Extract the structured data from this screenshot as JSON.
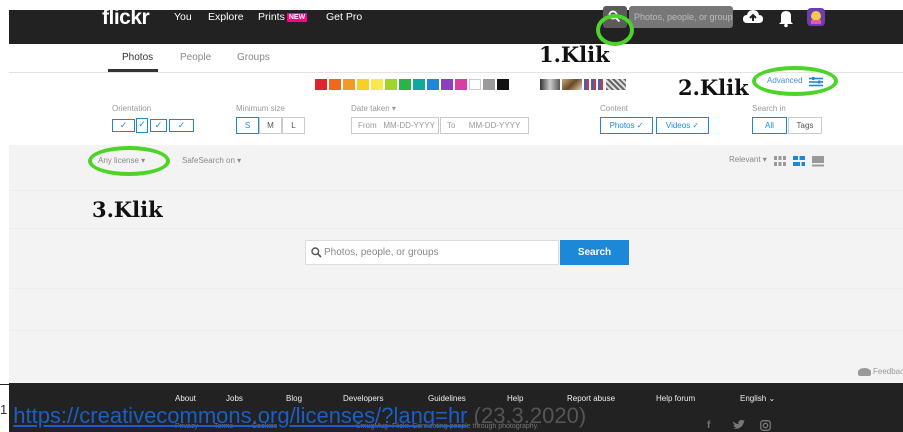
{
  "topbar": {
    "logo": "flickr",
    "nav": [
      "You",
      "Explore",
      "Prints",
      "Get Pro"
    ],
    "new_badge": "NEW",
    "search_placeholder": "Photos, people, or groups",
    "icons": [
      "search-icon",
      "upload-cloud-icon",
      "bell-icon",
      "avatar"
    ]
  },
  "annotations": {
    "step1": "1.Klik",
    "step2": "2.Klik",
    "step3": "3.Klik",
    "highlight_color": "#4cd428"
  },
  "tabs": [
    "Photos",
    "People",
    "Groups"
  ],
  "color_swatches": [
    "#e0232f",
    "#ee6a1a",
    "#f19a25",
    "#f6cf27",
    "#f7e94c",
    "#9fd42a",
    "#29b34b",
    "#10a9a0",
    "#1e88d8",
    "#8c3fc0",
    "#d63fa6",
    "#ffffff",
    "#9a9a9a",
    "#111111"
  ],
  "style_swatches": [
    "bw-style",
    "shallow-depth",
    "minimalist",
    "patterns"
  ],
  "advanced": {
    "label": "Advanced",
    "icon": "sliders-icon"
  },
  "filters": {
    "orientation": {
      "label": "Orientation",
      "options_checked": 4
    },
    "minimum_size": {
      "label": "Minimum size",
      "options": [
        "S",
        "M",
        "L"
      ]
    },
    "date_taken": {
      "label": "Date taken ▾",
      "from": "From",
      "from_placeholder": "MM-DD-YYYY",
      "to": "To",
      "to_placeholder": "MM-DD-YYYY"
    },
    "content": {
      "label": "Content",
      "photos": "Photos ✓",
      "videos": "Videos ✓"
    },
    "search_in": {
      "label": "Search in",
      "all": "All",
      "tags": "Tags"
    }
  },
  "toolbar": {
    "license": "Any license ▾",
    "safesearch": "SafeSearch on ▾",
    "sort": "Relevant ▾",
    "view_icons": [
      "grid-view-icon",
      "justified-view-icon",
      "list-view-icon"
    ]
  },
  "main_search": {
    "placeholder": "Photos, people, or groups",
    "button": "Search"
  },
  "feedback": "Feedback",
  "footer": {
    "links": [
      "About",
      "Jobs",
      "Blog",
      "Developers",
      "Guidelines",
      "Help",
      "Report abuse",
      "Help forum",
      "English ⌄"
    ],
    "sub_links": [
      "Privacy",
      "Terms",
      "Cookies"
    ],
    "tagline": "SmugMug+Flickr. Connecting people through photography.",
    "social_icons": [
      "facebook-icon",
      "twitter-icon",
      "instagram-icon"
    ]
  },
  "footnote": {
    "number": "1",
    "url": "https://creativecommons.org/licenses/?lang=hr",
    "date": "(23.3.2020)"
  }
}
